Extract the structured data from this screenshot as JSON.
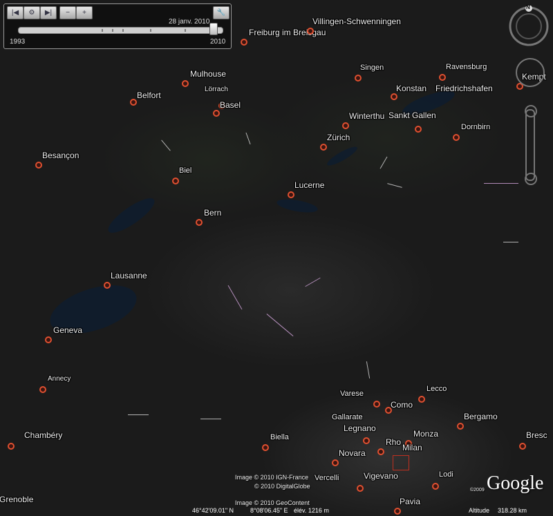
{
  "time_slider": {
    "current_date": "28 janv. 2010",
    "start_year": "1993",
    "end_year": "2010",
    "buttons": [
      "back-to-start-icon",
      "settings-icon",
      "forward-icon",
      "zoom-out-icon",
      "zoom-in-icon"
    ],
    "tool_icon": "wrench-icon"
  },
  "navigation": {
    "compass_label": "N"
  },
  "cities": [
    {
      "name": "Freiburg im Breisgau",
      "size": "big"
    },
    {
      "name": "Villingen-Schwenningen",
      "size": "big"
    },
    {
      "name": "Mulhouse",
      "size": "big"
    },
    {
      "name": "Belfort",
      "size": "big"
    },
    {
      "name": "Lörrach",
      "size": "small"
    },
    {
      "name": "Basel",
      "size": "big"
    },
    {
      "name": "Singen",
      "size": "normal"
    },
    {
      "name": "Ravensburg",
      "size": "normal"
    },
    {
      "name": "Kempt",
      "size": "big"
    },
    {
      "name": "Konstan",
      "size": "big"
    },
    {
      "name": "Friedrichshafen",
      "size": "big"
    },
    {
      "name": "Winterthu",
      "size": "big"
    },
    {
      "name": "Sankt Gallen",
      "size": "big"
    },
    {
      "name": "Dornbirn",
      "size": "normal"
    },
    {
      "name": "Zürich",
      "size": "big"
    },
    {
      "name": "Besançon",
      "size": "big"
    },
    {
      "name": "Biel",
      "size": "normal"
    },
    {
      "name": "Lucerne",
      "size": "big"
    },
    {
      "name": "Bern",
      "size": "big"
    },
    {
      "name": "Lausanne",
      "size": "big"
    },
    {
      "name": "Geneva",
      "size": "big"
    },
    {
      "name": "Annecy",
      "size": "small"
    },
    {
      "name": "Varese",
      "size": "normal"
    },
    {
      "name": "Como",
      "size": "big"
    },
    {
      "name": "Lecco",
      "size": "normal"
    },
    {
      "name": "Gallarate",
      "size": "normal"
    },
    {
      "name": "Bergamo",
      "size": "big"
    },
    {
      "name": "Legnano",
      "size": "big"
    },
    {
      "name": "Chambéry",
      "size": "big"
    },
    {
      "name": "Biella",
      "size": "normal"
    },
    {
      "name": "Monza",
      "size": "big"
    },
    {
      "name": "Bresc",
      "size": "big"
    },
    {
      "name": "Rho",
      "size": "big"
    },
    {
      "name": "Milan",
      "size": "big"
    },
    {
      "name": "Novara",
      "size": "big"
    },
    {
      "name": "Lodi",
      "size": "normal"
    },
    {
      "name": "Vercelli",
      "size": "normal"
    },
    {
      "name": "Vigevano",
      "size": "big"
    },
    {
      "name": "Grenoble",
      "size": "big"
    },
    {
      "name": "Pavia",
      "size": "big"
    }
  ],
  "attribution": {
    "line1": "Image © 2010 IGN-France",
    "line2": "© 2010 DigitalGlobe",
    "line3": "Image © 2010 GeoContent",
    "year_small": "©2009",
    "logo": "Google"
  },
  "status_bar": {
    "coordinates": "46°42'09.01\" N",
    "coordinates2": "8°08'06.45\" E",
    "elevation": "élév. 1216 m",
    "altitude_label": "Altitude",
    "altitude_value": "318.28 km"
  }
}
